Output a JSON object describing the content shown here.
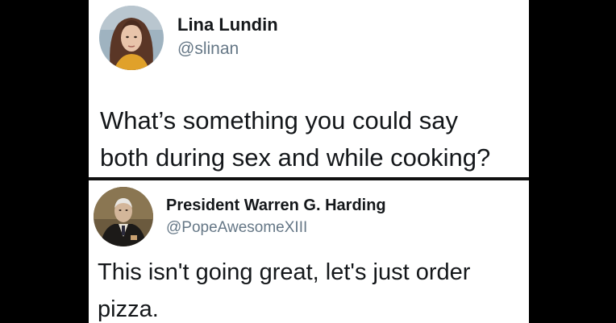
{
  "colors": {
    "background": "#000000",
    "card": "#ffffff",
    "name_text": "#14171a",
    "handle_text": "#657786",
    "divider": "#111111"
  },
  "tweets": [
    {
      "avatar_icon": "woman-portrait-avatar",
      "display_name": "Lina Lundin",
      "handle": "@slinan",
      "text_lines": [
        "What’s something you could say",
        "both during sex and while cooking?"
      ]
    },
    {
      "avatar_icon": "presidential-portrait-avatar",
      "display_name": "President Warren G. Harding",
      "handle": "@PopeAwesomeXIII",
      "text_lines": [
        "This isn't going great, let's just order",
        "pizza."
      ]
    }
  ]
}
